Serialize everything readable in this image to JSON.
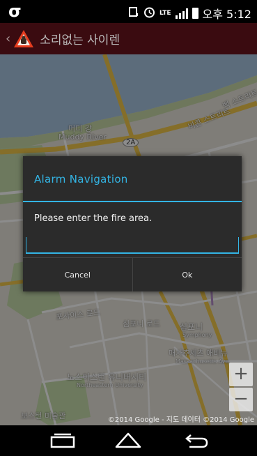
{
  "status_bar": {
    "logo": "σ",
    "network": "LTE",
    "time": "오후 5:12"
  },
  "action_bar": {
    "back_icon": "chevron-left-icon",
    "app_icon": "warning-siren-icon",
    "title": "소리없는 사이렌"
  },
  "map": {
    "labels": {
      "river_ko": "머디 강",
      "river_en": "Muddy River",
      "route": "2A",
      "back_street": "백 스트리트",
      "beacon_street": "비콘 스트리트",
      "symphony_ko": "심포니",
      "symphony_en": "Symphony",
      "mass_ave_ko": "매사추세츠 애비뉴",
      "mass_ave_en": "Massachusetts Ave",
      "neu_ko": "노스이스턴 유니버시티",
      "neu_en": "Northeastern University",
      "mfa": "보스턴 미술관",
      "symphony_rd": "심포니 로드",
      "forsyth": "포사이스 로드"
    },
    "copyright": "©2014 Google - 지도 데이터 ©2014 Google",
    "zoom_in": "+",
    "zoom_out": "−"
  },
  "dialog": {
    "title": "Alarm Navigation",
    "message": "Please enter the fire area.",
    "input_value": "",
    "cancel_label": "Cancel",
    "ok_label": "Ok"
  },
  "colors": {
    "accent": "#33b5e5",
    "action_bar_bg": "#3a0b10",
    "dialog_bg": "#2b2b2b"
  }
}
